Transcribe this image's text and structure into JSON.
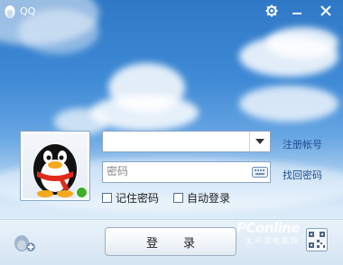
{
  "window": {
    "title": "QQ"
  },
  "titlebar": {
    "settings_icon": "gear-icon",
    "minimize_icon": "minimize-icon",
    "close_icon": "close-icon"
  },
  "login": {
    "account": {
      "value": "",
      "placeholder": ""
    },
    "password": {
      "value": "",
      "placeholder": "密码"
    },
    "register_link": "注册帐号",
    "recover_link": "找回密码",
    "remember_password_label": "记住密码",
    "auto_login_label": "自动登录",
    "remember_password_checked": false,
    "auto_login_checked": false,
    "login_button": "登录"
  },
  "watermark": {
    "logo": "PConline",
    "subtitle": "太平洋电脑网"
  },
  "colors": {
    "link": "#1d4e8f",
    "status_online": "#3fae2a",
    "sky_top": "#2f78c6"
  }
}
